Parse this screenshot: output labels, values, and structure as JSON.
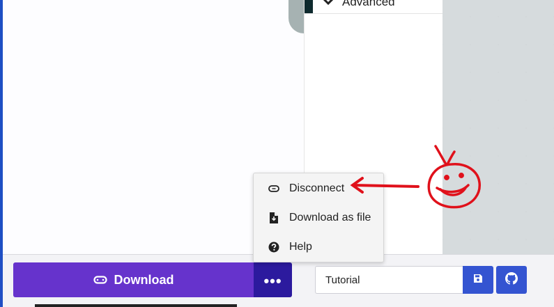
{
  "toolbox": {
    "advanced_label": "Advanced"
  },
  "bottom_bar": {
    "download_label": "Download",
    "more_label": "•••",
    "project_name_value": "Tutorial"
  },
  "menu": {
    "items": [
      {
        "label": "Disconnect",
        "icon": "link-icon"
      },
      {
        "label": "Download as file",
        "icon": "file-download-icon"
      },
      {
        "label": "Help",
        "icon": "help-circle-icon"
      }
    ]
  },
  "colors": {
    "download_purple": "#6633cc",
    "more_navy": "#2c1a9e",
    "action_blue": "#3454d1",
    "annotation_red": "#e0111b"
  }
}
